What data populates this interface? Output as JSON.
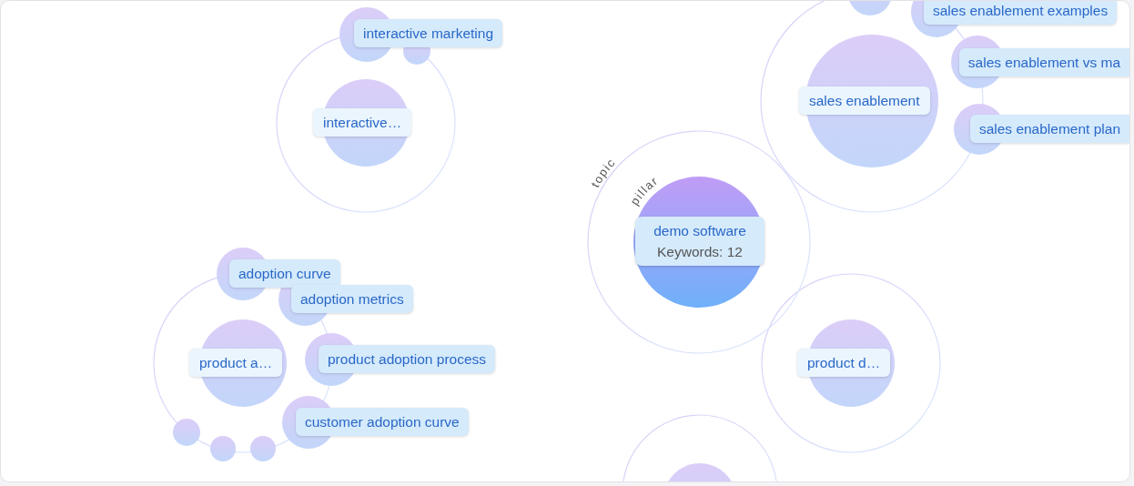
{
  "center": {
    "title": "demo software",
    "keywords": "Keywords: 12",
    "ring_labels": [
      "topic",
      "pillar"
    ]
  },
  "clusters": [
    {
      "label": "interactive…",
      "children": [
        {
          "label": "interactive marketing"
        }
      ]
    },
    {
      "label": "sales enablement",
      "children": [
        {
          "label": "sales enablement examples"
        },
        {
          "label": "sales enablement vs ma"
        },
        {
          "label": "sales enablement plan"
        }
      ]
    },
    {
      "label": "product a…",
      "children": [
        {
          "label": "adoption curve"
        },
        {
          "label": "adoption metrics"
        },
        {
          "label": "product adoption process"
        },
        {
          "label": "customer adoption curve"
        }
      ]
    },
    {
      "label": "product d…"
    }
  ]
}
